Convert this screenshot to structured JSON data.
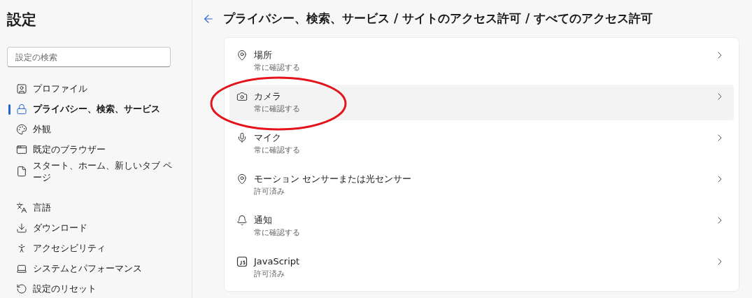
{
  "sidebar": {
    "title": "設定",
    "search": {
      "placeholder": "設定の検索"
    },
    "items": [
      {
        "label": "プロファイル",
        "selected": false
      },
      {
        "label": "プライバシー、検索、サービス",
        "selected": true
      },
      {
        "label": "外観",
        "selected": false
      },
      {
        "label": "既定のブラウザー",
        "selected": false
      },
      {
        "label": "スタート、ホーム、新しいタブ ページ",
        "selected": false
      },
      {
        "label": "言語",
        "selected": false
      },
      {
        "label": "ダウンロード",
        "selected": false
      },
      {
        "label": "アクセシビリティ",
        "selected": false
      },
      {
        "label": "システムとパフォーマンス",
        "selected": false
      },
      {
        "label": "設定のリセット",
        "selected": false
      }
    ]
  },
  "main": {
    "breadcrumb": "プライバシー、検索、サービス / サイトのアクセス許可 / すべてのアクセス許可",
    "permissions": [
      {
        "title": "場所",
        "status": "常に確認する",
        "highlighted": false,
        "circled": false
      },
      {
        "title": "カメラ",
        "status": "常に確認する",
        "highlighted": true,
        "circled": true
      },
      {
        "title": "マイク",
        "status": "常に確認する",
        "highlighted": false,
        "circled": false
      },
      {
        "title": "モーション センサーまたは光センサー",
        "status": "許可済み",
        "highlighted": false,
        "circled": false
      },
      {
        "title": "通知",
        "status": "常に確認する",
        "highlighted": false,
        "circled": false
      },
      {
        "title": "JavaScript",
        "status": "許可済み",
        "highlighted": false,
        "circled": false
      }
    ]
  }
}
